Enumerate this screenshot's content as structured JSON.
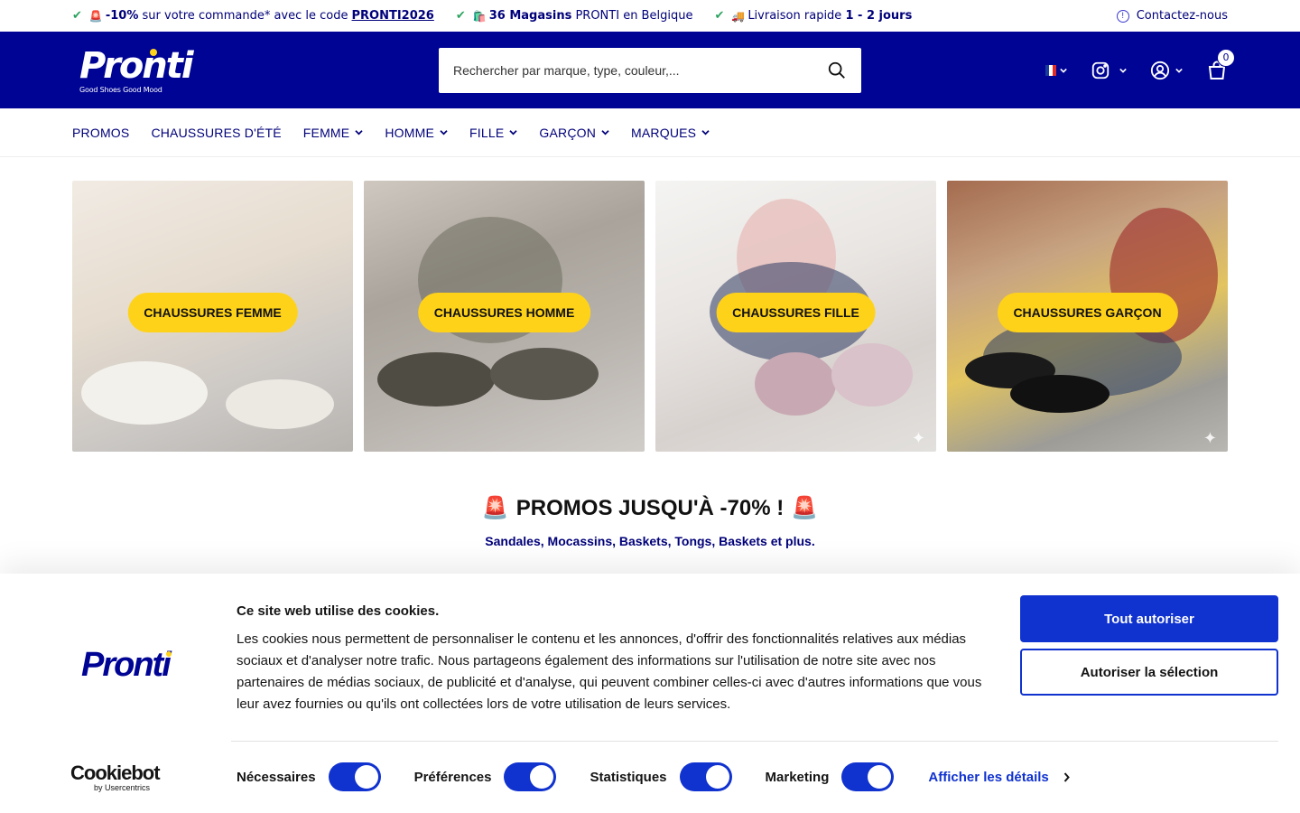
{
  "topbar": {
    "promo": {
      "emoji": "🚨",
      "highlight": "-10%",
      "text": "sur votre commande* avec le code",
      "code": "PRONTI2026"
    },
    "stores": {
      "emoji": "🛍️",
      "highlight": "36 Magasins",
      "text": "PRONTI en Belgique"
    },
    "delivery": {
      "emoji": "🚚",
      "text": "Livraison rapide",
      "highlight": "1 - 2 jours"
    },
    "contact": "Contactez-nous"
  },
  "header": {
    "logo_text": "Pronti",
    "logo_tagline": "Good Shoes Good Mood",
    "search_placeholder": "Rechercher par marque, type, couleur,...",
    "cart_count": "0",
    "brand_color": "#000494",
    "accent_color": "#ffd21a"
  },
  "nav": {
    "items": [
      {
        "label": "PROMOS",
        "dropdown": false
      },
      {
        "label": "CHAUSSURES D'ÉTÉ",
        "dropdown": false
      },
      {
        "label": "FEMME",
        "dropdown": true
      },
      {
        "label": "HOMME",
        "dropdown": true
      },
      {
        "label": "FILLE",
        "dropdown": true
      },
      {
        "label": "GARÇON",
        "dropdown": true
      },
      {
        "label": "MARQUES",
        "dropdown": true
      }
    ]
  },
  "categories": [
    {
      "label": "CHAUSSURES FEMME"
    },
    {
      "label": "CHAUSSURES HOMME"
    },
    {
      "label": "CHAUSSURES FILLE"
    },
    {
      "label": "CHAUSSURES GARÇON"
    }
  ],
  "promo_section": {
    "emoji": "🚨",
    "title": "PROMOS JUSQU'À -70% !",
    "subtitle": "Sandales, Mocassins, Baskets, Tongs, Baskets et plus."
  },
  "cookie_banner": {
    "logo_text": "Pronti",
    "title": "Ce site web utilise des cookies.",
    "body": "Les cookies nous permettent de personnaliser le contenu et les annonces, d'offrir des fonctionnalités relatives aux médias sociaux et d'analyser notre trafic. Nous partageons également des informations sur l'utilisation de notre site avec nos partenaires de médias sociaux, de publicité et d'analyse, qui peuvent combiner celles-ci avec d'autres informations que vous leur avez fournies ou qu'ils ont collectées lors de votre utilisation de leurs services.",
    "allow_all": "Tout autoriser",
    "allow_selection": "Autoriser la sélection",
    "provider_name": "Cookiebot",
    "provider_by": "by Usercentrics",
    "toggles": [
      {
        "label": "Nécessaires",
        "checked": true
      },
      {
        "label": "Préférences",
        "checked": true
      },
      {
        "label": "Statistiques",
        "checked": true
      },
      {
        "label": "Marketing",
        "checked": true
      }
    ],
    "details_link": "Afficher les détails",
    "button_color": "#1032cf"
  }
}
